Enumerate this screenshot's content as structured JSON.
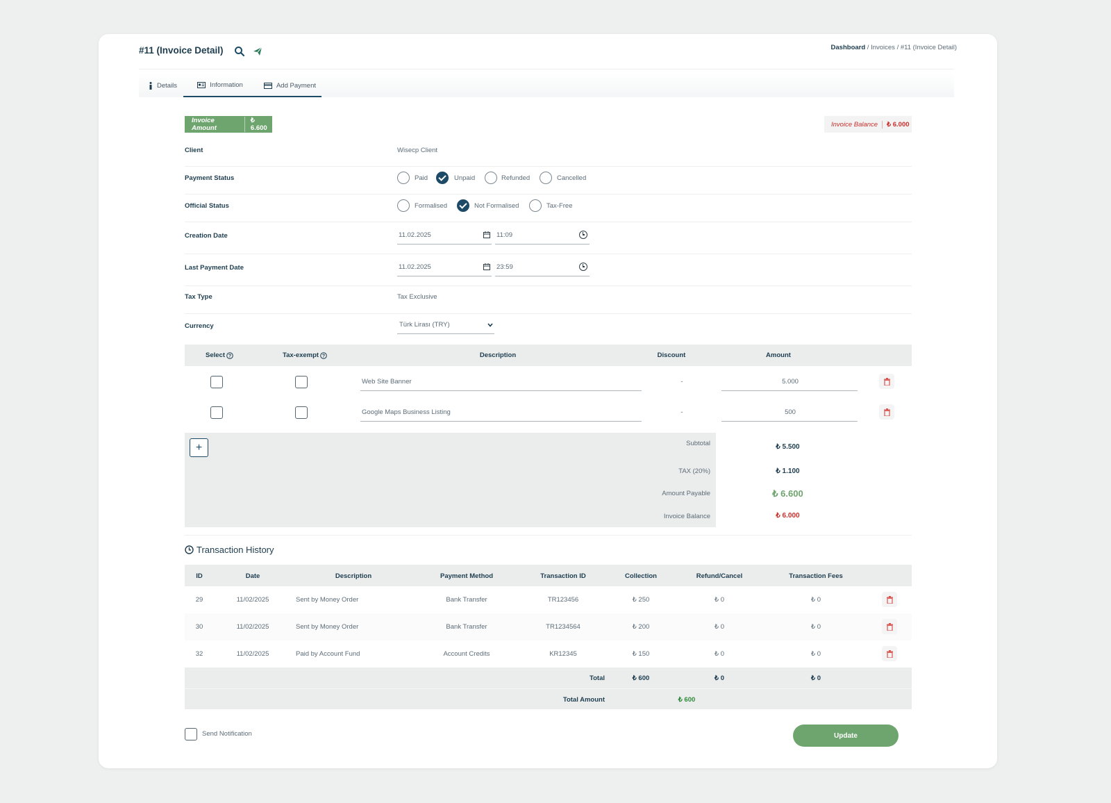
{
  "header": {
    "title": "#11 (Invoice Detail)",
    "breadcrumb": {
      "home": "Dashboard",
      "sep1": "/",
      "section": "Invoices",
      "sep2": "/",
      "current": "#11 (Invoice Detail)"
    }
  },
  "tabs": [
    {
      "label": "Details",
      "icon": "info-icon"
    },
    {
      "label": "Information",
      "icon": "id-card-icon",
      "active": true
    },
    {
      "label": "Add Payment",
      "icon": "credit-card-icon"
    }
  ],
  "badges": {
    "invoice_amount_label": "Invoice Amount",
    "invoice_amount_value": "₺ 6.600",
    "invoice_balance_label": "Invoice Balance",
    "invoice_balance_value": "₺ 6.000"
  },
  "form": {
    "client_label": "Client",
    "client_value": "Wisecp Client",
    "payment_status_label": "Payment Status",
    "payment_status_options": [
      "Paid",
      "Unpaid",
      "Refunded",
      "Cancelled"
    ],
    "payment_status_selected": "Unpaid",
    "official_status_label": "Official Status",
    "official_status_options": [
      "Formalised",
      "Not Formalised",
      "Tax-Free"
    ],
    "official_status_selected": "Not Formalised",
    "creation_date_label": "Creation Date",
    "creation_date": "11.02.2025",
    "creation_time": "11:09",
    "last_payment_date_label": "Last Payment Date",
    "last_payment_date": "11.02.2025",
    "last_payment_time": "23:59",
    "tax_type_label": "Tax Type",
    "tax_type_value": "Tax Exclusive",
    "currency_label": "Currency",
    "currency_value": "Türk Lirası (TRY)"
  },
  "items_table": {
    "headers": {
      "select": "Select",
      "tax_exempt": "Tax-exempt",
      "description": "Description",
      "discount": "Discount",
      "amount": "Amount"
    },
    "rows": [
      {
        "description": "Web Site Banner",
        "discount": "-",
        "amount": "5.000"
      },
      {
        "description": "Google Maps Business Listing",
        "discount": "-",
        "amount": "500"
      }
    ],
    "add_button": "+",
    "summary": {
      "subtotal_label": "Subtotal",
      "subtotal": "₺ 5.500",
      "tax_label": "TAX (20%)",
      "tax": "₺ 1.100",
      "payable_label": "Amount Payable",
      "payable": "₺ 6.600",
      "balance_label": "Invoice Balance",
      "balance": "₺ 6.000"
    }
  },
  "transactions": {
    "title": "Transaction History",
    "headers": [
      "ID",
      "Date",
      "Description",
      "Payment Method",
      "Transaction ID",
      "Collection",
      "Refund/Cancel",
      "Transaction Fees"
    ],
    "rows": [
      [
        "29",
        "11/02/2025",
        "Sent by Money Order",
        "Bank Transfer",
        "TR123456",
        "₺ 250",
        "₺ 0",
        "₺ 0"
      ],
      [
        "30",
        "11/02/2025",
        "Sent by Money Order",
        "Bank Transfer",
        "TR1234564",
        "₺ 200",
        "₺ 0",
        "₺ 0"
      ],
      [
        "32",
        "11/02/2025",
        "Paid by Account Fund",
        "Account Credits",
        "KR12345",
        "₺ 150",
        "₺ 0",
        "₺ 0"
      ]
    ],
    "total_label": "Total",
    "total_collection": "₺ 600",
    "total_refund": "₺ 0",
    "total_fees": "₺ 0",
    "total_amount_label": "Total Amount",
    "total_amount": "₺ 600"
  },
  "footer": {
    "send_notification": "Send Notification",
    "update_button": "Update"
  },
  "colors": {
    "primary": "#1d4a66",
    "green": "#6ea56e",
    "red": "#c8302c",
    "muted": "#ebecec"
  }
}
